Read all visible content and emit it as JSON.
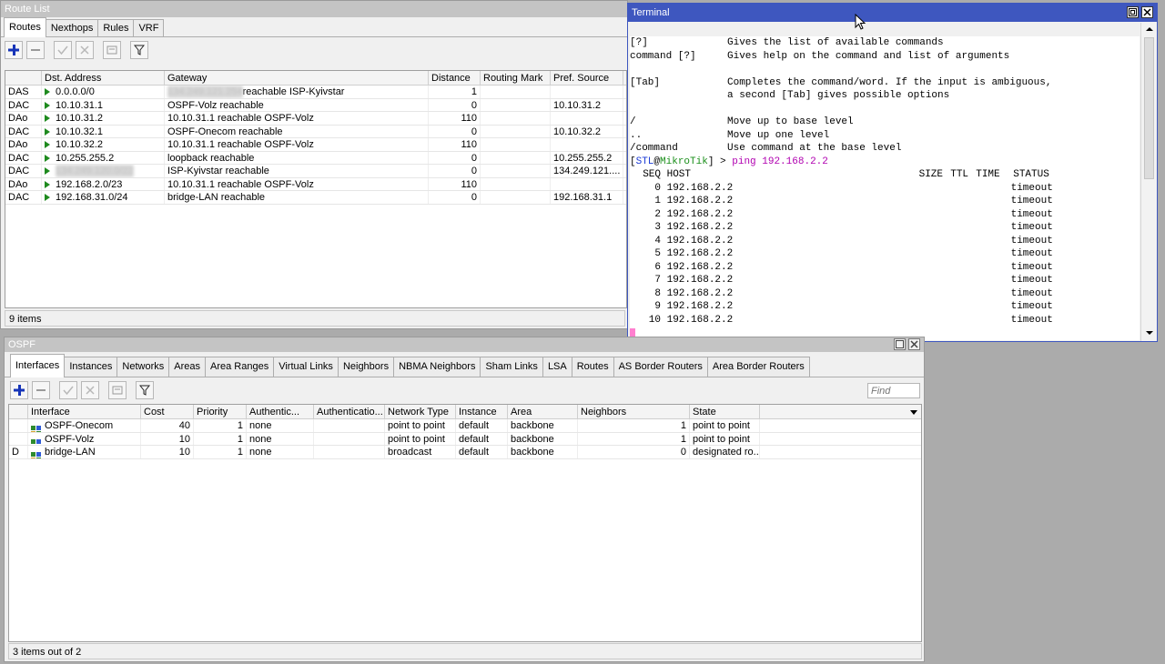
{
  "route_list": {
    "title": "Route List",
    "tabs": [
      "Routes",
      "Nexthops",
      "Rules",
      "VRF"
    ],
    "columns": [
      "",
      "Dst. Address",
      "Gateway",
      "Distance",
      "Routing Mark",
      "Pref. Source"
    ],
    "rows": [
      {
        "flags": "DAS",
        "dst": "0.0.0.0/0",
        "gw_blurred": "134.249.121.254",
        "gw": "reachable ISP-Kyivstar",
        "distance": "1",
        "mark": "",
        "src": ""
      },
      {
        "flags": "DAC",
        "dst": "10.10.31.1",
        "gw": "OSPF-Volz reachable",
        "distance": "0",
        "mark": "",
        "src": "10.10.31.2"
      },
      {
        "flags": "DAo",
        "dst": "10.10.31.2",
        "gw": "10.10.31.1 reachable OSPF-Volz",
        "distance": "110",
        "mark": "",
        "src": ""
      },
      {
        "flags": "DAC",
        "dst": "10.10.32.1",
        "gw": "OSPF-Onecom reachable",
        "distance": "0",
        "mark": "",
        "src": "10.10.32.2"
      },
      {
        "flags": "DAo",
        "dst": "10.10.32.2",
        "gw": "10.10.31.1 reachable OSPF-Volz",
        "distance": "110",
        "mark": "",
        "src": ""
      },
      {
        "flags": "DAC",
        "dst": "10.255.255.2",
        "gw": "loopback reachable",
        "distance": "0",
        "mark": "",
        "src": "10.255.255.2"
      },
      {
        "flags": "DAC",
        "dst_blurred": "134.249.120.0/22",
        "gw": "ISP-Kyivstar reachable",
        "distance": "0",
        "mark": "",
        "src": "134.249.121...."
      },
      {
        "flags": "DAo",
        "dst": "192.168.2.0/23",
        "gw": "10.10.31.1 reachable OSPF-Volz",
        "distance": "110",
        "mark": "",
        "src": ""
      },
      {
        "flags": "DAC",
        "dst": "192.168.31.0/24",
        "gw": "bridge-LAN reachable",
        "distance": "0",
        "mark": "",
        "src": "192.168.31.1"
      }
    ],
    "status": "9 items"
  },
  "terminal": {
    "title": "Terminal",
    "help_lines": [
      {
        "key": "[?]",
        "desc": "Gives the list of available commands"
      },
      {
        "key": "command [?]",
        "desc": "Gives help on the command and list of arguments"
      },
      {
        "key": "",
        "desc": ""
      },
      {
        "key": "[Tab]",
        "desc": "Completes the command/word. If the input is ambiguous,"
      },
      {
        "key": "",
        "desc": "a second [Tab] gives possible options"
      },
      {
        "key": "",
        "desc": ""
      },
      {
        "key": "/",
        "desc": "Move up to base level"
      },
      {
        "key": "..",
        "desc": "Move up one level"
      },
      {
        "key": "/command",
        "desc": "Use command at the base level"
      }
    ],
    "prompt_user": "STL",
    "prompt_host": "MikroTik",
    "prompt_cmd": "ping 192.168.2.2",
    "ping_header": {
      "seq": "SEQ",
      "host": "HOST",
      "size": "SIZE",
      "ttl": "TTL",
      "time": "TIME",
      "status": "STATUS"
    },
    "ping_rows": [
      {
        "seq": "0",
        "host": "192.168.2.2",
        "status": "timeout"
      },
      {
        "seq": "1",
        "host": "192.168.2.2",
        "status": "timeout"
      },
      {
        "seq": "2",
        "host": "192.168.2.2",
        "status": "timeout"
      },
      {
        "seq": "3",
        "host": "192.168.2.2",
        "status": "timeout"
      },
      {
        "seq": "4",
        "host": "192.168.2.2",
        "status": "timeout"
      },
      {
        "seq": "5",
        "host": "192.168.2.2",
        "status": "timeout"
      },
      {
        "seq": "6",
        "host": "192.168.2.2",
        "status": "timeout"
      },
      {
        "seq": "7",
        "host": "192.168.2.2",
        "status": "timeout"
      },
      {
        "seq": "8",
        "host": "192.168.2.2",
        "status": "timeout"
      },
      {
        "seq": "9",
        "host": "192.168.2.2",
        "status": "timeout"
      },
      {
        "seq": "10",
        "host": "192.168.2.2",
        "status": "timeout"
      }
    ],
    "colors": {
      "prompt_user": "#1a3ad6",
      "prompt_host": "#1a8f1a",
      "command": "#b000b0",
      "cursor": "#ff7fcf"
    }
  },
  "ospf": {
    "title": "OSPF",
    "tabs": [
      "Interfaces",
      "Instances",
      "Networks",
      "Areas",
      "Area Ranges",
      "Virtual Links",
      "Neighbors",
      "NBMA Neighbors",
      "Sham Links",
      "LSA",
      "Routes",
      "AS Border Routers",
      "Area Border Routers"
    ],
    "find_placeholder": "Find",
    "columns": [
      "",
      "Interface",
      "Cost",
      "Priority",
      "Authentic...",
      "Authenticatio...",
      "Network Type",
      "Instance",
      "Area",
      "Neighbors",
      "State"
    ],
    "rows": [
      {
        "flag": "",
        "iface": "OSPF-Onecom",
        "cost": "40",
        "priority": "1",
        "auth": "none",
        "auth_key": "",
        "net_type": "point to point",
        "instance": "default",
        "area": "backbone",
        "neighbors": "1",
        "state": "point to point"
      },
      {
        "flag": "",
        "iface": "OSPF-Volz",
        "cost": "10",
        "priority": "1",
        "auth": "none",
        "auth_key": "",
        "net_type": "point to point",
        "instance": "default",
        "area": "backbone",
        "neighbors": "1",
        "state": "point to point"
      },
      {
        "flag": "D",
        "iface": "bridge-LAN",
        "cost": "10",
        "priority": "1",
        "auth": "none",
        "auth_key": "",
        "net_type": "broadcast",
        "instance": "default",
        "area": "backbone",
        "neighbors": "0",
        "state": "designated ro..."
      }
    ],
    "status": "3 items out of 2"
  }
}
